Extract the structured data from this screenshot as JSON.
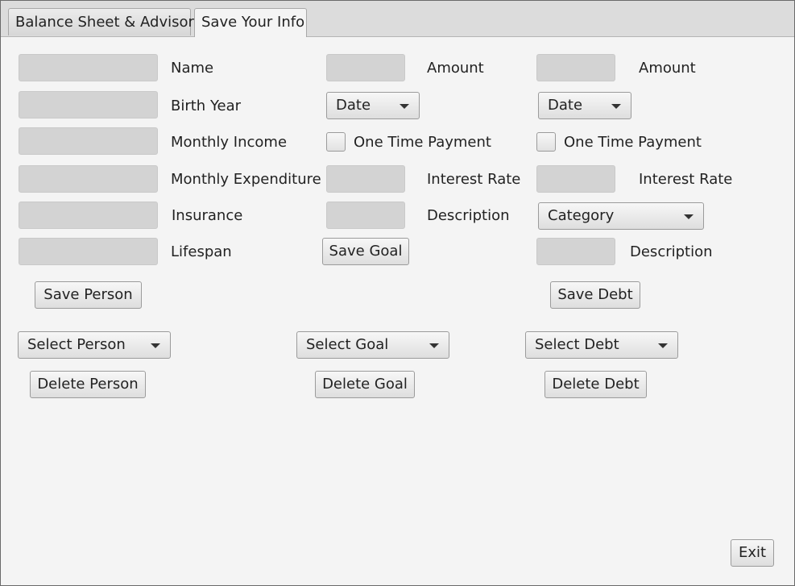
{
  "tabs": [
    {
      "label": "Balance Sheet & Advisor",
      "active": false
    },
    {
      "label": "Save Your Info",
      "active": true
    }
  ],
  "person": {
    "fields": [
      {
        "label": "Name",
        "value": ""
      },
      {
        "label": "Birth Year",
        "value": ""
      },
      {
        "label": "Monthly Income",
        "value": ""
      },
      {
        "label": "Monthly Expenditure",
        "value": ""
      },
      {
        "label": "Insurance",
        "value": ""
      },
      {
        "label": "Lifespan",
        "value": ""
      }
    ],
    "save_label": "Save Person",
    "select_label": "Select Person",
    "delete_label": "Delete Person"
  },
  "goal": {
    "amount_label": "Amount",
    "date_label": "Date",
    "one_time_label": "One Time Payment",
    "interest_label": "Interest Rate",
    "description_label": "Description",
    "save_label": "Save Goal",
    "select_label": "Select Goal",
    "delete_label": "Delete Goal"
  },
  "debt": {
    "amount_label": "Amount",
    "date_label": "Date",
    "one_time_label": "One Time Payment",
    "interest_label": "Interest Rate",
    "category_label": "Category",
    "description_label": "Description",
    "save_label": "Save Debt",
    "select_label": "Select Debt",
    "delete_label": "Delete Debt"
  },
  "exit_label": "Exit"
}
